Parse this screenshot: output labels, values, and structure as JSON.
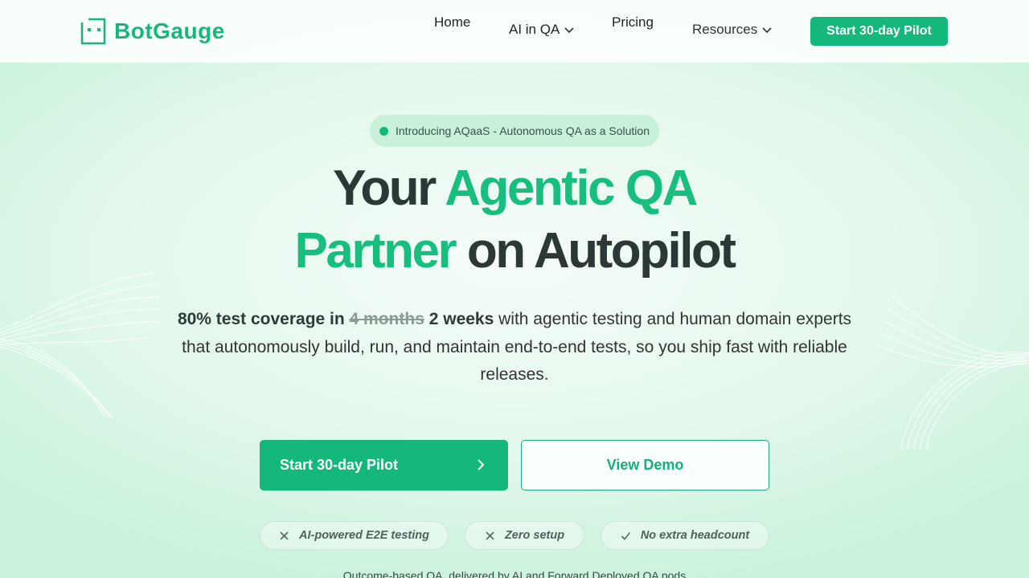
{
  "brand": {
    "name": "BotGauge",
    "accent": "#14b87a"
  },
  "nav": {
    "items": [
      {
        "label": "Home"
      },
      {
        "label": "AI in QA"
      },
      {
        "label": "Pricing"
      },
      {
        "label": "Resources"
      }
    ],
    "cta_label": "Start 30-day Pilot"
  },
  "hero": {
    "badge": "Introducing AQaaS - Autonomous QA as a Solution",
    "headline": {
      "line1_plain": "Your ",
      "line1_accent": "Agentic QA",
      "line2_accent": "Partner",
      "line2_plain": " on Autopilot"
    },
    "lead": {
      "bold_prefix": "80% test coverage in ",
      "strike": "4 months",
      "bold_new": " 2 weeks",
      "rest": " with agentic testing and human domain experts that autonomously build, run, and maintain end-to-end tests, so you ship fast with reliable releases."
    },
    "primary_button": "Start 30-day Pilot",
    "secondary_button": "View Demo",
    "pills": [
      {
        "label": "AI-powered E2E testing",
        "icon": "x-icon"
      },
      {
        "label": "Zero setup",
        "icon": "x-icon"
      },
      {
        "label": "No extra headcount",
        "icon": "check-icon"
      }
    ],
    "footer_line": "Outcome-based QA, delivered by AI and Forward Deployed QA pods"
  }
}
